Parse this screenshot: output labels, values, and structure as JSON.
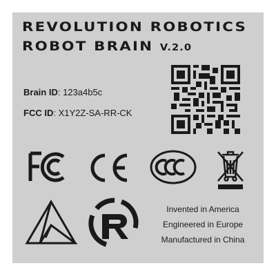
{
  "label": {
    "title_line1": "REVOLUTION ROBOTICS",
    "title_line2": "ROBOT BRAIN",
    "version": "V.2.0",
    "brain_id_label": "Brain ID",
    "brain_id_value": ": 123a4b5c",
    "fcc_id_label": "FCC ID",
    "fcc_id_value": ": X1Y2Z-SA-RR-CK",
    "origin_line1": "Invented in America",
    "origin_line2": "Engineered in Europe",
    "origin_line3": "Manufactured in China"
  },
  "icons": {
    "qr": "qr-code-icon",
    "fc": "fcc-mark-icon",
    "ce": "ce-mark-icon",
    "ccc": "ccc-mark-icon",
    "weee": "weee-crossed-bin-icon",
    "triangle": "triangle-logo-icon",
    "r_logo": "revolution-r-logo-icon"
  },
  "colors": {
    "background": "#cfcfcf",
    "ink": "#1a1a1a"
  }
}
